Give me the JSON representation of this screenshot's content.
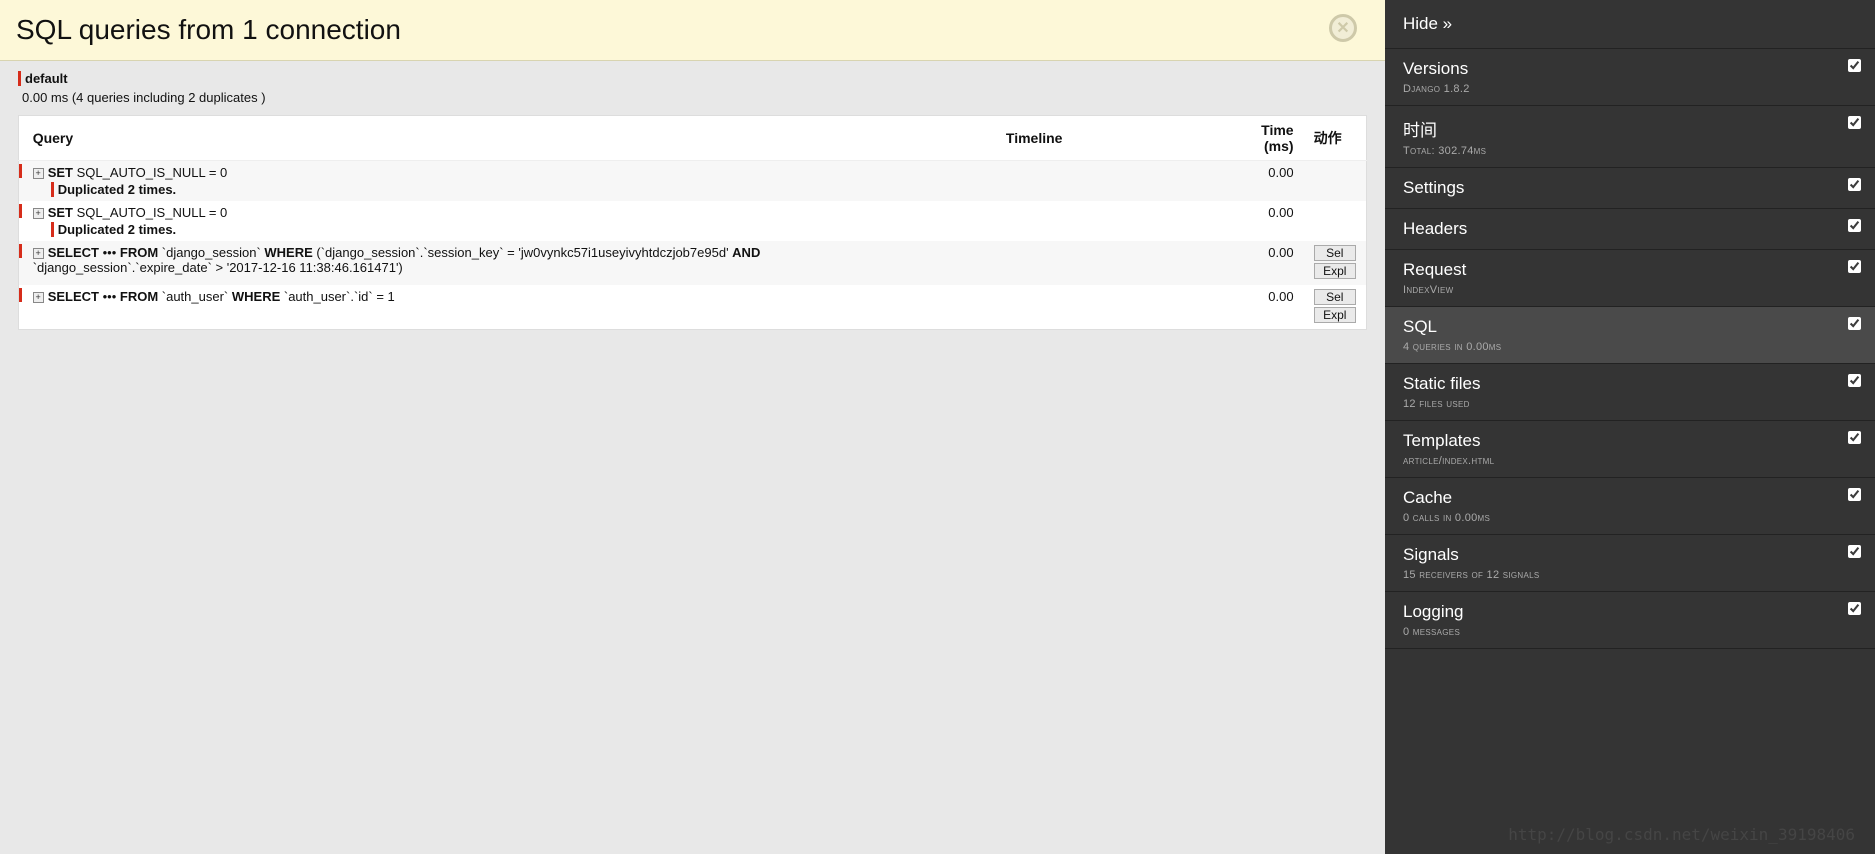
{
  "header": {
    "title": "SQL queries from 1 connection"
  },
  "connection": {
    "name": "default",
    "summary": "0.00 ms (4 queries including 2 duplicates )"
  },
  "table": {
    "headers": {
      "query": "Query",
      "timeline": "Timeline",
      "time": "Time (ms)",
      "action": "动作"
    },
    "rows": [
      {
        "sql_html": "<span class='kw'>SET</span> SQL_AUTO_IS_NULL = 0",
        "dup": "Duplicated 2 times.",
        "time": "0.00",
        "actions": []
      },
      {
        "sql_html": "<span class='kw'>SET</span> SQL_AUTO_IS_NULL = 0",
        "dup": "Duplicated 2 times.",
        "time": "0.00",
        "actions": []
      },
      {
        "sql_html": "<span class='kw'>SELECT</span> ••• <span class='kw'>FROM</span> `django_session` <span class='kw'>WHERE</span> (`django_session`.`session_key` = 'jw0vynkc57i1useyivyhtdczjob7e95d' <span class='kw'>AND</span> `django_session`.`expire_date` &gt; '2017-12-16 11:38:46.161471')",
        "dup": null,
        "time": "0.00",
        "actions": [
          "Sel",
          "Expl"
        ]
      },
      {
        "sql_html": "<span class='kw'>SELECT</span> ••• <span class='kw'>FROM</span> `auth_user` <span class='kw'>WHERE</span> `auth_user`.`id` = 1",
        "dup": null,
        "time": "0.00",
        "actions": [
          "Sel",
          "Expl"
        ]
      }
    ]
  },
  "sidebar": {
    "hide_label": "Hide »",
    "panels": [
      {
        "title": "Versions",
        "sub": "Django 1.8.2",
        "checked": true,
        "active": false
      },
      {
        "title": "时间",
        "sub": "Total: 302.74ms",
        "checked": true,
        "active": false
      },
      {
        "title": "Settings",
        "sub": null,
        "checked": true,
        "active": false
      },
      {
        "title": "Headers",
        "sub": null,
        "checked": true,
        "active": false
      },
      {
        "title": "Request",
        "sub": "IndexView",
        "checked": true,
        "active": false
      },
      {
        "title": "SQL",
        "sub": "4 queries in 0.00ms",
        "checked": true,
        "active": true
      },
      {
        "title": "Static files",
        "sub": "12 files used",
        "checked": true,
        "active": false
      },
      {
        "title": "Templates",
        "sub": "article/index.html",
        "checked": true,
        "active": false
      },
      {
        "title": "Cache",
        "sub": "0 calls in 0.00ms",
        "checked": true,
        "active": false
      },
      {
        "title": "Signals",
        "sub": "15 receivers of 12 signals",
        "checked": true,
        "active": false
      },
      {
        "title": "Logging",
        "sub": "0 messages",
        "checked": true,
        "active": false
      }
    ]
  },
  "watermark": "http://blog.csdn.net/weixin_39198406"
}
